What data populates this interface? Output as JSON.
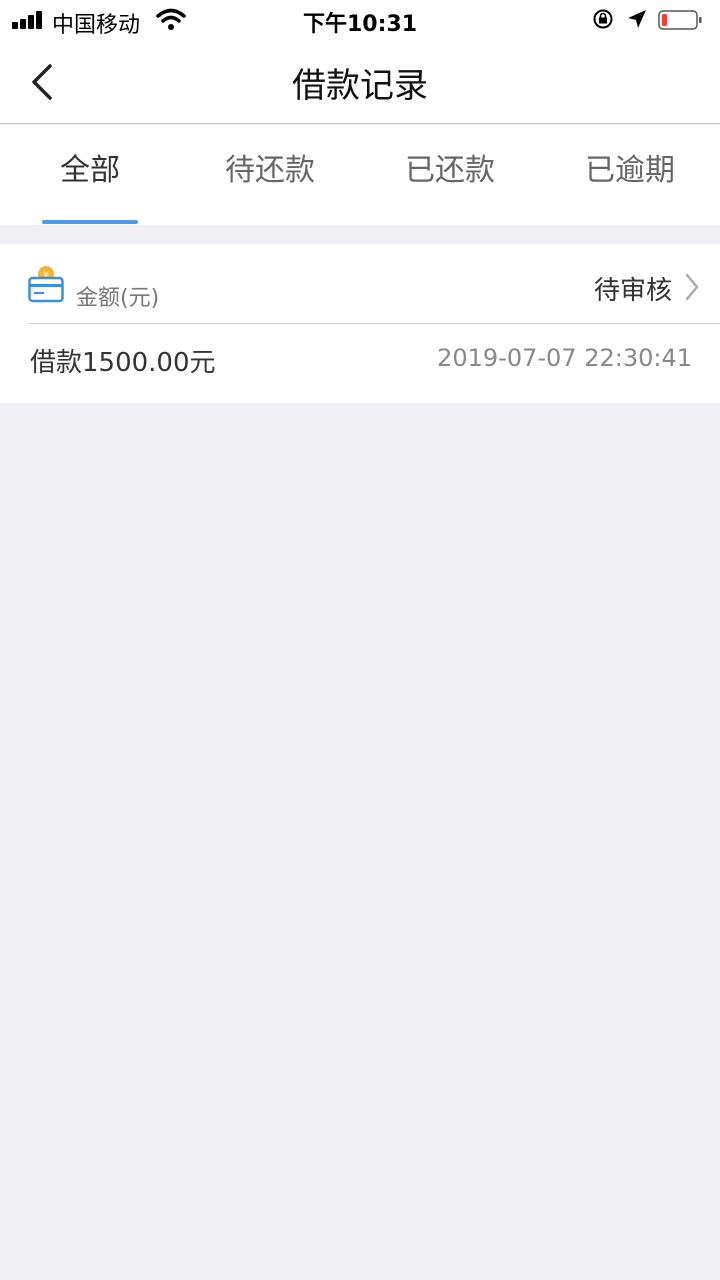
{
  "status_bar": {
    "carrier": "中国移动",
    "time": "下午10:31",
    "icons": [
      "signal-icon",
      "wifi-icon",
      "orientation-lock-icon",
      "location-icon",
      "battery-icon"
    ],
    "battery_color": "#ff3b30"
  },
  "nav": {
    "title": "借款记录",
    "back_icon": "chevron-left-icon"
  },
  "tabs": [
    {
      "label": "全部",
      "active": true
    },
    {
      "label": "待还款",
      "active": false
    },
    {
      "label": "已还款",
      "active": false
    },
    {
      "label": "已逾期",
      "active": false
    }
  ],
  "accent_color": "#4a9be8",
  "record": {
    "label": "金额(元)",
    "status": "待审核",
    "amount_text": "借款1500.00元",
    "timestamp": "2019-07-07 22:30:41",
    "icon": "money-card-icon"
  }
}
